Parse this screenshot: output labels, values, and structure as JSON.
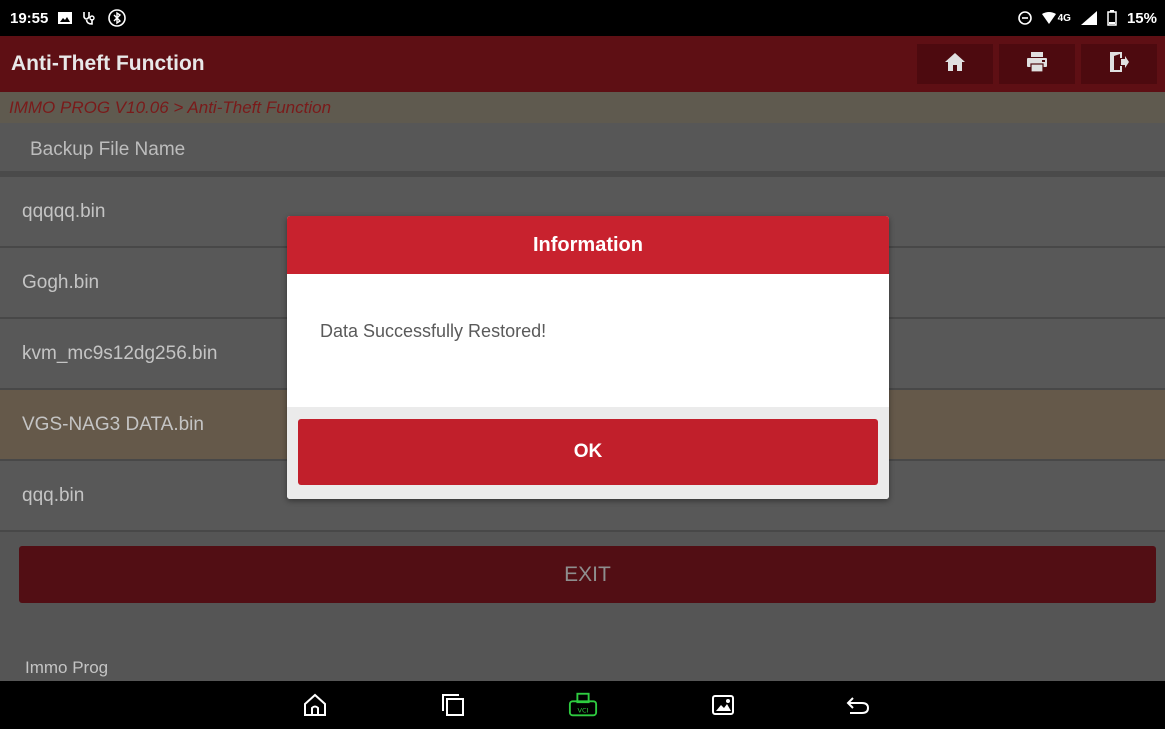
{
  "status": {
    "time": "19:55",
    "battery": "15%",
    "network": "4G"
  },
  "header": {
    "title": "Anti-Theft Function",
    "icons": [
      "home-icon",
      "printer-icon",
      "exit-door-icon"
    ]
  },
  "breadcrumb": "IMMO PROG V10.06 > Anti-Theft Function",
  "list": {
    "header": "Backup File Name",
    "items": [
      {
        "label": "qqqqq.bin"
      },
      {
        "label": "Gogh.bin"
      },
      {
        "label": "kvm_mc9s12dg256.bin"
      },
      {
        "label": "VGS-NAG3 DATA.bin"
      },
      {
        "label": "qqq.bin"
      }
    ],
    "selected_index": 3
  },
  "exit_label": "EXIT",
  "footer_label": "Immo Prog",
  "dialog": {
    "title": "Information",
    "message": "Data Successfully Restored!",
    "ok_label": "OK"
  },
  "colors": {
    "accent": "#c8222e",
    "title_bar": "#5e0f14",
    "vci_green": "#2ecc40"
  }
}
